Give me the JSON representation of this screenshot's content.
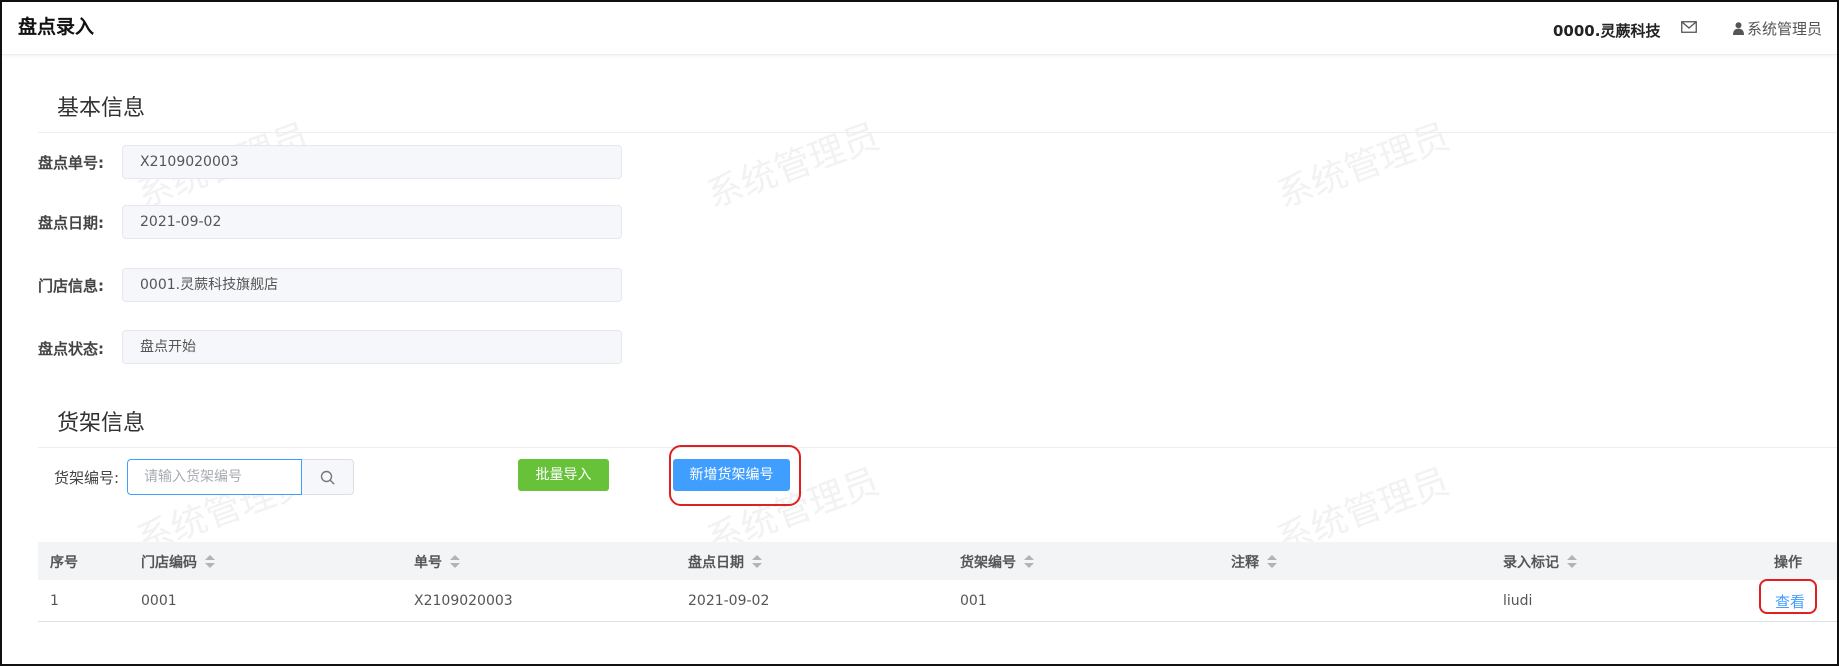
{
  "header": {
    "title": "盘点录入",
    "company": "0000.灵蕨科技",
    "user": "系统管理员",
    "icons": [
      "mail-icon",
      "user-icon"
    ]
  },
  "watermark": "系统管理员",
  "basic": {
    "section_title": "基本信息",
    "fields": [
      {
        "label": "盘点单号:",
        "value": "X2109020003"
      },
      {
        "label": "盘点日期:",
        "value": "2021-09-02"
      },
      {
        "label": "门店信息:",
        "value": "0001.灵蕨科技旗舰店"
      },
      {
        "label": "盘点状态:",
        "value": "盘点开始"
      }
    ]
  },
  "shelf": {
    "section_title": "货架信息",
    "label": "货架编号:",
    "placeholder": "请输入货架编号",
    "import_button": "批量导入",
    "add_button": "新增货架编号"
  },
  "table": {
    "columns": [
      "序号",
      "门店编码",
      "单号",
      "盘点日期",
      "货架编号",
      "注释",
      "录入标记",
      "操作"
    ],
    "rows": [
      [
        "1",
        "0001",
        "X2109020003",
        "2021-09-02",
        "001",
        "",
        "liudi",
        "查看"
      ]
    ]
  },
  "colors": {
    "primary": "#409eff",
    "success": "#67c23a",
    "highlight": "#e02020"
  }
}
